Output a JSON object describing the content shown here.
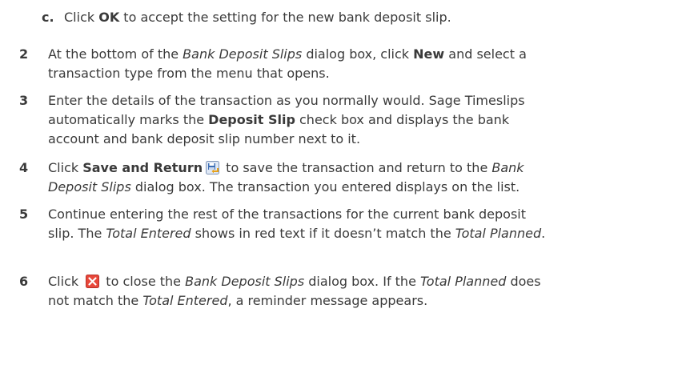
{
  "substep_c": {
    "marker": "c.",
    "t1": "Click ",
    "b1": "OK",
    "t2": " to accept the setting for the new bank deposit slip."
  },
  "steps": [
    {
      "number": "2",
      "lines": {
        "l1_t1": "At the bottom of the ",
        "l1_i1": "Bank Deposit Slips",
        "l1_t2": " dialog box, click ",
        "l1_b1": "New",
        "l1_t3": " and select a",
        "l2_t1": "transaction type from the menu that opens."
      }
    },
    {
      "number": "3",
      "lines": {
        "l1_t1": "Enter the details of the transaction as you normally would. Sage Timeslips",
        "l2_t1": "automatically marks the ",
        "l2_b1": "Deposit Slip",
        "l2_t2": " check box and displays the bank",
        "l3_t1": "account and bank deposit slip number next to it."
      }
    },
    {
      "number": "4",
      "icon": "save-and-return-icon",
      "lines": {
        "l1_t1": "Click ",
        "l1_b1": "Save and Return",
        "l1_t2": " to save the transaction and return to the ",
        "l1_i1": "Bank",
        "l2_i1": "Deposit Slips",
        "l2_t1": " dialog box. The transaction you entered displays on the list."
      }
    },
    {
      "number": "5",
      "lines": {
        "l1_t1": "Continue entering the rest of the transactions for the current bank deposit",
        "l2_t1": "slip. The ",
        "l2_i1": "Total Entered",
        "l2_t2": " shows in red text if it doesn’t match the ",
        "l2_i2": "Total Planned",
        "l2_t3": "."
      }
    },
    {
      "number": "6",
      "icon": "close-icon",
      "lines": {
        "l1_t1": "Click ",
        "l1_t2": " to close the ",
        "l1_i1": "Bank Deposit Slips",
        "l1_t3": " dialog box. If the ",
        "l1_i2": "Total Planned",
        "l1_t4": " does",
        "l2_t1": "not match the ",
        "l2_i1": "Total Entered",
        "l2_t2": ", a reminder message appears."
      }
    }
  ],
  "colors": {
    "text": "#3a3a3a",
    "close_icon_red": "#e8473a",
    "save_icon_blue": "#3d6fb5"
  }
}
